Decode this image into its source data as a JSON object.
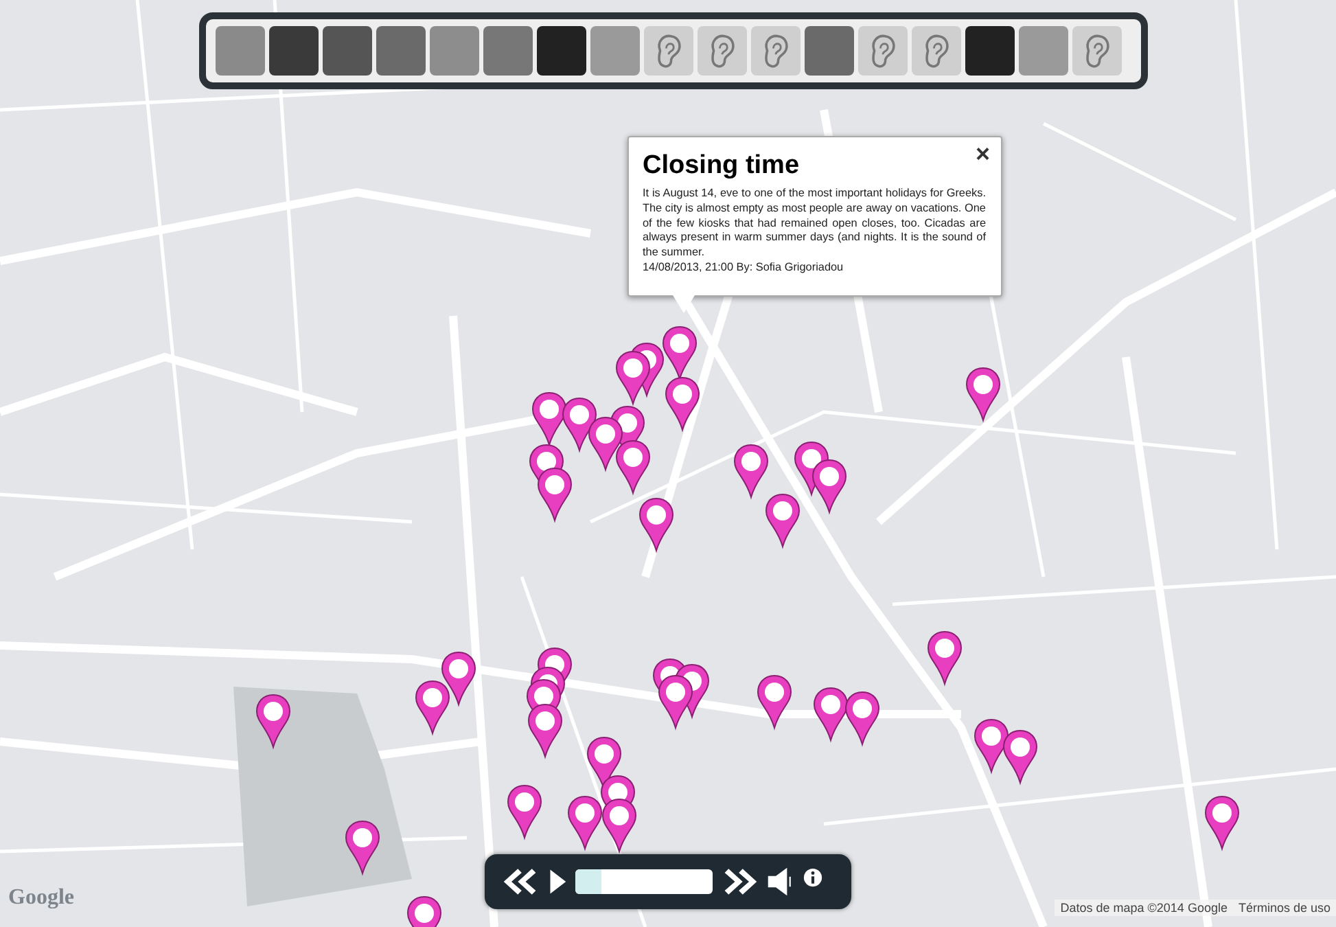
{
  "thumbnails": [
    {
      "kind": "photo",
      "selected": false
    },
    {
      "kind": "photo",
      "selected": false
    },
    {
      "kind": "photo",
      "selected": false
    },
    {
      "kind": "photo",
      "selected": false
    },
    {
      "kind": "photo",
      "selected": false
    },
    {
      "kind": "photo",
      "selected": false
    },
    {
      "kind": "photo",
      "selected": false
    },
    {
      "kind": "photo",
      "selected": false
    },
    {
      "kind": "ear",
      "selected": false
    },
    {
      "kind": "ear",
      "selected": false
    },
    {
      "kind": "ear",
      "selected": false
    },
    {
      "kind": "photo",
      "selected": false
    },
    {
      "kind": "ear",
      "selected": false
    },
    {
      "kind": "ear",
      "selected": false
    },
    {
      "kind": "photo",
      "selected": false
    },
    {
      "kind": "photo",
      "selected": false
    },
    {
      "kind": "ear",
      "selected": false
    }
  ],
  "popup": {
    "title": "Closing time",
    "close": "×",
    "text": "It is August 14, eve to one of the most important holidays for Greeks. The city is almost empty as most people are away on vacations. One of the few kiosks that had remained open closes, too. Cicadas are always present in warm summer days (and nights. It is the sound of the summer.",
    "meta": "14/08/2013, 21:00 By: Sofia Grigoriadou"
  },
  "player": {
    "level": 0.19
  },
  "map": {
    "logo": "Google",
    "attribution": "Datos de mapa ©2014 Google",
    "terms": "Términos de uso"
  }
}
